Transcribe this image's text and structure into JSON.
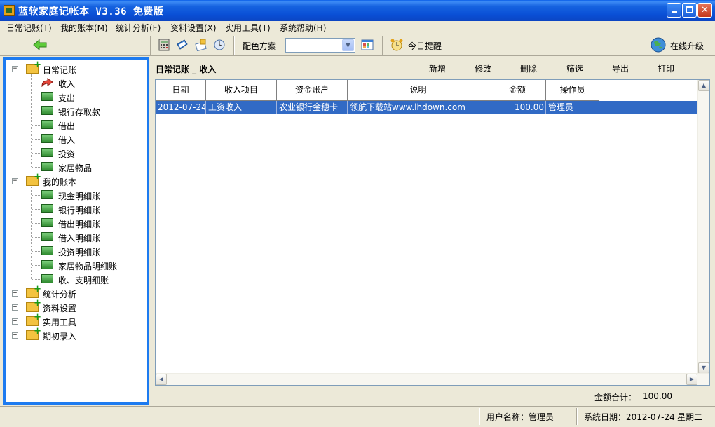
{
  "window": {
    "title": "蓝软家庭记帐本 V3.36  免费版"
  },
  "menu": [
    {
      "label": "日常记账(T)"
    },
    {
      "label": "我的账本(M)"
    },
    {
      "label": "统计分析(F)"
    },
    {
      "label": "资料设置(X)"
    },
    {
      "label": "实用工具(T)"
    },
    {
      "label": "系统帮助(H)"
    }
  ],
  "toolbar": {
    "color_scheme_label": "配色方案",
    "color_scheme_value": "",
    "reminder_label": "今日提醒",
    "upgrade_label": "在线升级"
  },
  "tree": {
    "groups": [
      {
        "label": "日常记账",
        "expanded": true,
        "items": [
          "收入",
          "支出",
          "银行存取款",
          "借出",
          "借入",
          "投资",
          "家居物品"
        ]
      },
      {
        "label": "我的账本",
        "expanded": true,
        "items": [
          "现金明细账",
          "银行明细账",
          "借出明细账",
          "借入明细账",
          "投资明细账",
          "家居物品明细账",
          "收、支明细账"
        ]
      },
      {
        "label": "统计分析",
        "expanded": false,
        "items": []
      },
      {
        "label": "资料设置",
        "expanded": false,
        "items": []
      },
      {
        "label": "实用工具",
        "expanded": false,
        "items": []
      },
      {
        "label": "期初录入",
        "expanded": false,
        "items": []
      }
    ]
  },
  "panel": {
    "title": "日常记账 _ 收入",
    "actions": [
      "新增",
      "修改",
      "删除",
      "筛选",
      "导出",
      "打印"
    ]
  },
  "table": {
    "columns": [
      "日期",
      "收入项目",
      "资金账户",
      "说明",
      "金额",
      "操作员"
    ],
    "rows": [
      [
        "2012-07-24",
        "工资收入",
        "农业银行金穗卡",
        "领航下载站www.lhdown.com",
        "100.00",
        "管理员"
      ]
    ]
  },
  "summary": {
    "label": "金额合计：",
    "value": "100.00"
  },
  "status": {
    "user": "用户名称：管理员",
    "date": "系统日期：2012-07-24",
    "weekday": "星期二"
  }
}
